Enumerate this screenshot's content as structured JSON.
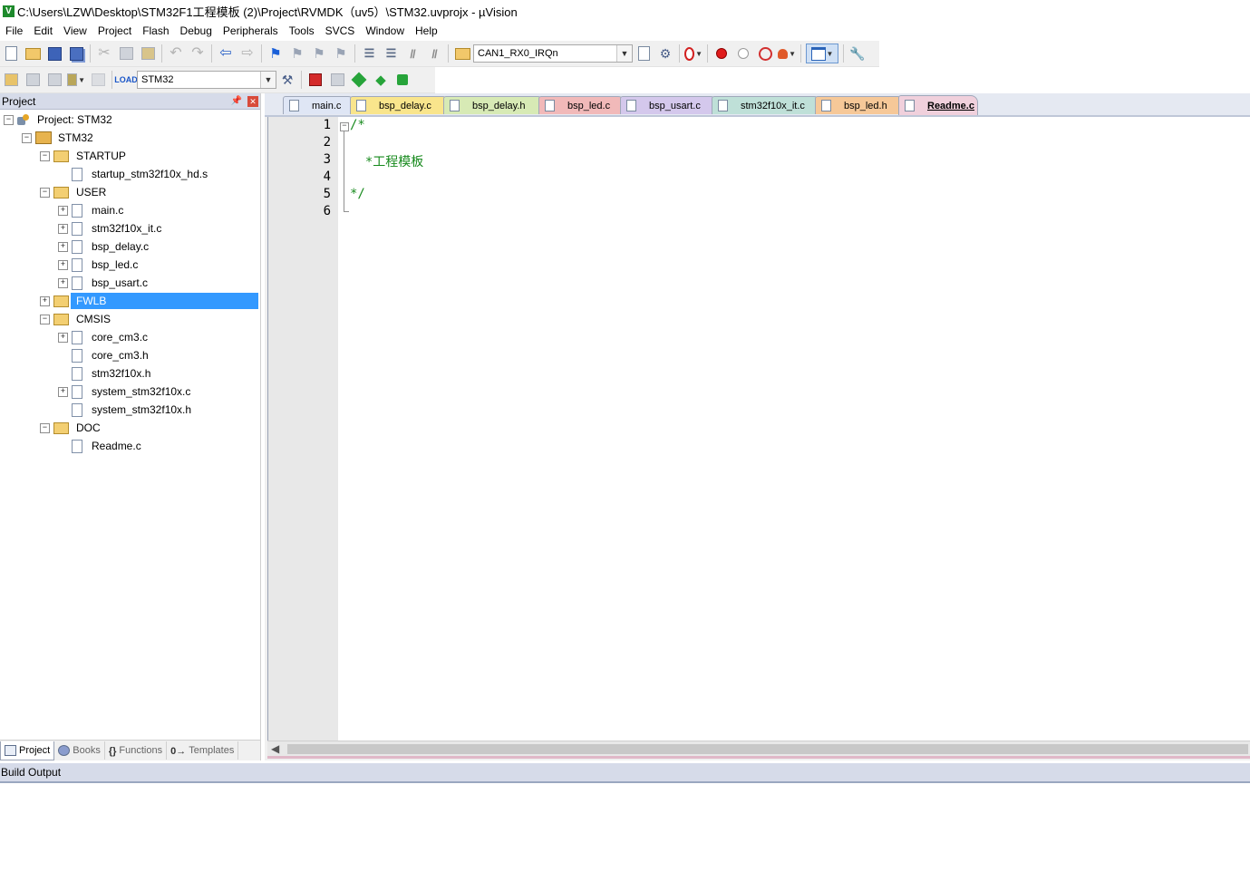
{
  "window": {
    "title": "C:\\Users\\LZW\\Desktop\\STM32F1工程模板 (2)\\Project\\RVMDK（uv5）\\STM32.uvprojx - µVision",
    "app_icon": "V"
  },
  "menu": [
    "File",
    "Edit",
    "View",
    "Project",
    "Flash",
    "Debug",
    "Peripherals",
    "Tools",
    "SVCS",
    "Window",
    "Help"
  ],
  "toolbar": {
    "function_combo": "CAN1_RX0_IRQn",
    "target_combo": "STM32",
    "load_label": "LOAD"
  },
  "project_panel": {
    "title": "Project",
    "tree": [
      {
        "label": "Project: STM32",
        "type": "project",
        "depth": 0,
        "expander": "−"
      },
      {
        "label": "STM32",
        "type": "target",
        "depth": 1,
        "expander": "−"
      },
      {
        "label": "STARTUP",
        "type": "folder",
        "depth": 2,
        "expander": "−"
      },
      {
        "label": "startup_stm32f10x_hd.s",
        "type": "file",
        "depth": 3,
        "expander": ""
      },
      {
        "label": "USER",
        "type": "folder",
        "depth": 2,
        "expander": "−"
      },
      {
        "label": "main.c",
        "type": "file",
        "depth": 3,
        "expander": "+"
      },
      {
        "label": "stm32f10x_it.c",
        "type": "file",
        "depth": 3,
        "expander": "+"
      },
      {
        "label": "bsp_delay.c",
        "type": "file",
        "depth": 3,
        "expander": "+"
      },
      {
        "label": "bsp_led.c",
        "type": "file",
        "depth": 3,
        "expander": "+"
      },
      {
        "label": "bsp_usart.c",
        "type": "file",
        "depth": 3,
        "expander": "+"
      },
      {
        "label": "FWLB",
        "type": "folder",
        "depth": 2,
        "expander": "+",
        "selected": true
      },
      {
        "label": "CMSIS",
        "type": "folder",
        "depth": 2,
        "expander": "−"
      },
      {
        "label": "core_cm3.c",
        "type": "file",
        "depth": 3,
        "expander": "+"
      },
      {
        "label": "core_cm3.h",
        "type": "file",
        "depth": 3,
        "expander": ""
      },
      {
        "label": "stm32f10x.h",
        "type": "file",
        "depth": 3,
        "expander": ""
      },
      {
        "label": "system_stm32f10x.c",
        "type": "file",
        "depth": 3,
        "expander": "+"
      },
      {
        "label": "system_stm32f10x.h",
        "type": "file",
        "depth": 3,
        "expander": ""
      },
      {
        "label": "DOC",
        "type": "folder",
        "depth": 2,
        "expander": "−"
      },
      {
        "label": "Readme.c",
        "type": "file",
        "depth": 3,
        "expander": ""
      }
    ],
    "bottom_tabs": [
      {
        "label": "Project",
        "icon": "project-icon",
        "active": true
      },
      {
        "label": "Books",
        "icon": "books-icon",
        "active": false
      },
      {
        "label": "Functions",
        "icon": "functions-icon",
        "active": false
      },
      {
        "label": "Templates",
        "icon": "templates-icon",
        "active": false
      }
    ]
  },
  "editor": {
    "tabs": [
      {
        "label": "main.c",
        "color": "#dfe6f5",
        "active": false
      },
      {
        "label": "bsp_delay.c",
        "color": "#f9e58c",
        "active": false
      },
      {
        "label": "bsp_delay.h",
        "color": "#d7eab5",
        "active": false
      },
      {
        "label": "bsp_led.c",
        "color": "#f1b9b9",
        "active": false
      },
      {
        "label": "bsp_usart.c",
        "color": "#d4c8ec",
        "active": false
      },
      {
        "label": "stm32f10x_it.c",
        "color": "#bfe0d8",
        "active": false
      },
      {
        "label": "bsp_led.h",
        "color": "#f6c898",
        "active": false
      },
      {
        "label": "Readme.c",
        "color": "#f0d0dc",
        "active": true
      }
    ],
    "line_numbers": [
      "1",
      "2",
      "3",
      "4",
      "5",
      "6"
    ],
    "lines": [
      "/*",
      "",
      "  *工程模板",
      "",
      "*/",
      ""
    ],
    "code_color": "#178a1d"
  },
  "build_output": {
    "title": "Build Output"
  }
}
